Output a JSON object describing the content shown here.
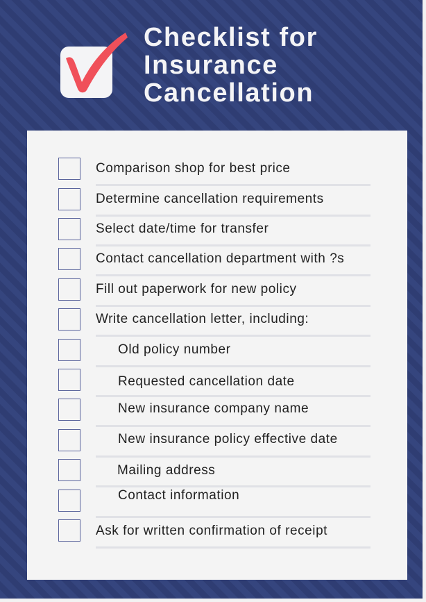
{
  "title": {
    "lines": [
      "Checklist for",
      "Insurance",
      "Cancellation"
    ]
  },
  "logo": {
    "icon": "checkbox-checked-icon",
    "check_color": "#f0505a",
    "box_color": "#f4f4f6"
  },
  "colors": {
    "background_stripe_a": "#35457e",
    "background_stripe_b": "#2f3d73",
    "card": "#f4f4f4",
    "checkbox_border": "#5a649c",
    "text": "#222222"
  },
  "checklist": {
    "items": [
      {
        "label": "Comparison shop for best price",
        "checked": false,
        "indent": 0
      },
      {
        "label": "Determine cancellation requirements",
        "checked": false,
        "indent": 0
      },
      {
        "label": "Select date/time for transfer",
        "checked": false,
        "indent": 0
      },
      {
        "label": "Contact cancellation department with ?s",
        "checked": false,
        "indent": 0
      },
      {
        "label": "Fill out paperwork for new policy",
        "checked": false,
        "indent": 0
      },
      {
        "label": "Write cancellation letter, including:",
        "checked": false,
        "indent": 0
      },
      {
        "label": "Old policy number",
        "checked": false,
        "indent": 1
      },
      {
        "label": "Requested cancellation date",
        "checked": false,
        "indent": 1
      },
      {
        "label": "New insurance company name",
        "checked": false,
        "indent": 1
      },
      {
        "label": "New insurance policy effective date",
        "checked": false,
        "indent": 1
      },
      {
        "label": "Mailing address",
        "checked": false,
        "indent": 1
      },
      {
        "label": "Contact information",
        "checked": false,
        "indent": 1
      },
      {
        "label": "Ask for written confirmation of receipt",
        "checked": false,
        "indent": 0
      }
    ]
  }
}
